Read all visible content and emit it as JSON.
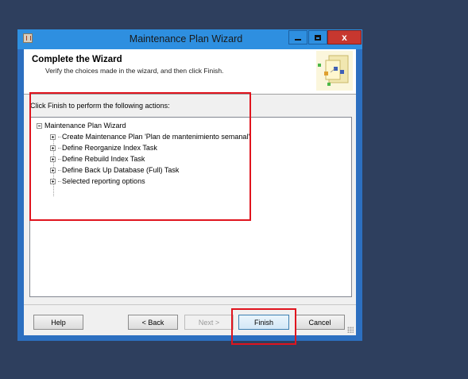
{
  "window": {
    "title": "Maintenance Plan Wizard",
    "close_glyph": "x"
  },
  "header": {
    "title": "Complete the Wizard",
    "subtitle": "Verify the choices made in the wizard, and then click Finish."
  },
  "body": {
    "prompt": "Click Finish to perform the following actions:",
    "tree": {
      "root": "Maintenance Plan Wizard",
      "items": [
        "Create Maintenance Plan 'Plan de mantenimiento semanal'",
        "Define Reorganize Index Task",
        "Define Rebuild Index Task",
        "Define Back Up Database (Full) Task",
        "Selected reporting options"
      ]
    }
  },
  "buttons": {
    "help": "Help",
    "back": "< Back",
    "next": "Next >",
    "finish": "Finish",
    "cancel": "Cancel"
  },
  "colors": {
    "desktop": "#2e3f5e",
    "titlebar": "#2e8fe0",
    "close": "#c7372f",
    "highlight": "#e0141e"
  },
  "icons": [
    "app-icon",
    "minimize-icon",
    "maximize-icon",
    "close-icon",
    "wizard-header-image",
    "collapse-icon",
    "expand-icon",
    "resize-grip-icon"
  ]
}
